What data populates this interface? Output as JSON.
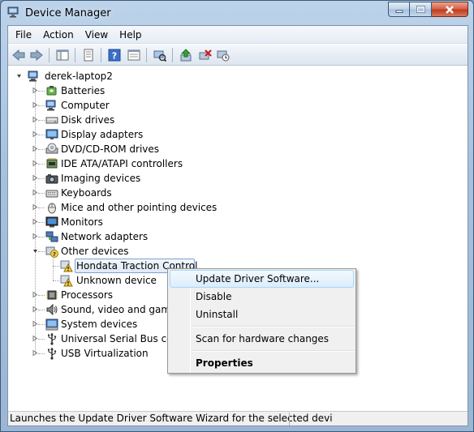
{
  "window": {
    "title": "Device Manager"
  },
  "menubar": {
    "items": [
      "File",
      "Action",
      "View",
      "Help"
    ]
  },
  "toolbar": {
    "buttons": [
      "back-icon",
      "forward-icon",
      "show-hide-tree-icon",
      "properties-icon",
      "help-icon",
      "scan-hardware-icon",
      "update-driver-icon",
      "uninstall-icon",
      "disable-icon"
    ]
  },
  "tree": {
    "root": "derek-laptop2",
    "categories": [
      "Batteries",
      "Computer",
      "Disk drives",
      "Display adapters",
      "DVD/CD-ROM drives",
      "IDE ATA/ATAPI controllers",
      "Imaging devices",
      "Keyboards",
      "Mice and other pointing devices",
      "Monitors",
      "Network adapters",
      "Other devices"
    ],
    "other_devices_children": [
      "Hondata Traction Control",
      "Unknown device"
    ],
    "categories_after": [
      "Processors",
      "Sound, video and game c",
      "System devices",
      "Universal Serial Bus contr",
      "USB Virtualization"
    ]
  },
  "context_menu": {
    "update": "Update Driver Software...",
    "disable": "Disable",
    "uninstall": "Uninstall",
    "scan": "Scan for hardware changes",
    "properties": "Properties"
  },
  "status": {
    "text": "Launches the Update Driver Software Wizard for the selected devi"
  }
}
